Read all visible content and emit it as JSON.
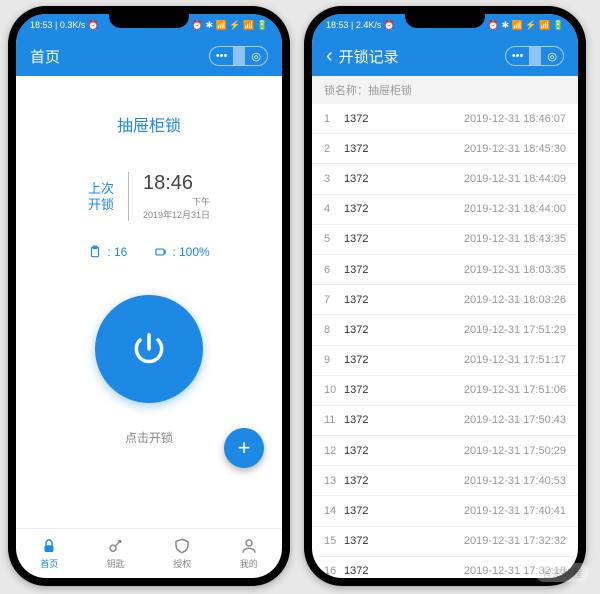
{
  "statusbar": {
    "time": "18:53",
    "speed_a": "0.3K/s",
    "speed_b": "2.4K/s",
    "icons": "⏰  ✱ 📶 ⚡ 📶 🔋"
  },
  "phoneA": {
    "title": "首页",
    "lock_name": "抽屉柜锁",
    "last_label_1": "上次",
    "last_label_2": "开锁",
    "last_time": "18:46",
    "last_ampm": "下午",
    "last_date": "2019年12月31日",
    "count_label": ": 16",
    "battery_label": ": 100%",
    "tap_hint": "点击开锁",
    "tabs": [
      "首页",
      "钥匙",
      "授权",
      "我的"
    ]
  },
  "phoneB": {
    "title": "开锁记录",
    "subhead_prefix": "锁名称：",
    "subhead_name": "抽屉柜锁",
    "records": [
      {
        "i": "1",
        "code": "1372",
        "ts": "2019-12-31 18:46:07"
      },
      {
        "i": "2",
        "code": "1372",
        "ts": "2019-12-31 18:45:30"
      },
      {
        "i": "3",
        "code": "1372",
        "ts": "2019-12-31 18:44:09"
      },
      {
        "i": "4",
        "code": "1372",
        "ts": "2019-12-31 18:44:00"
      },
      {
        "i": "5",
        "code": "1372",
        "ts": "2019-12-31 18:43:35"
      },
      {
        "i": "6",
        "code": "1372",
        "ts": "2019-12-31 18:03:35"
      },
      {
        "i": "7",
        "code": "1372",
        "ts": "2019-12-31 18:03:26"
      },
      {
        "i": "8",
        "code": "1372",
        "ts": "2019-12-31 17:51:29"
      },
      {
        "i": "9",
        "code": "1372",
        "ts": "2019-12-31 17:51:17"
      },
      {
        "i": "10",
        "code": "1372",
        "ts": "2019-12-31 17:51:06"
      },
      {
        "i": "11",
        "code": "1372",
        "ts": "2019-12-31 17:50:43"
      },
      {
        "i": "12",
        "code": "1372",
        "ts": "2019-12-31 17:50:29"
      },
      {
        "i": "13",
        "code": "1372",
        "ts": "2019-12-31 17:40:53"
      },
      {
        "i": "14",
        "code": "1372",
        "ts": "2019-12-31 17:40:41"
      },
      {
        "i": "15",
        "code": "1372",
        "ts": "2019-12-31 17:32:32"
      },
      {
        "i": "16",
        "code": "1372",
        "ts": "2019-12-31 17:32:18"
      }
    ]
  },
  "watermark": "智家教程"
}
